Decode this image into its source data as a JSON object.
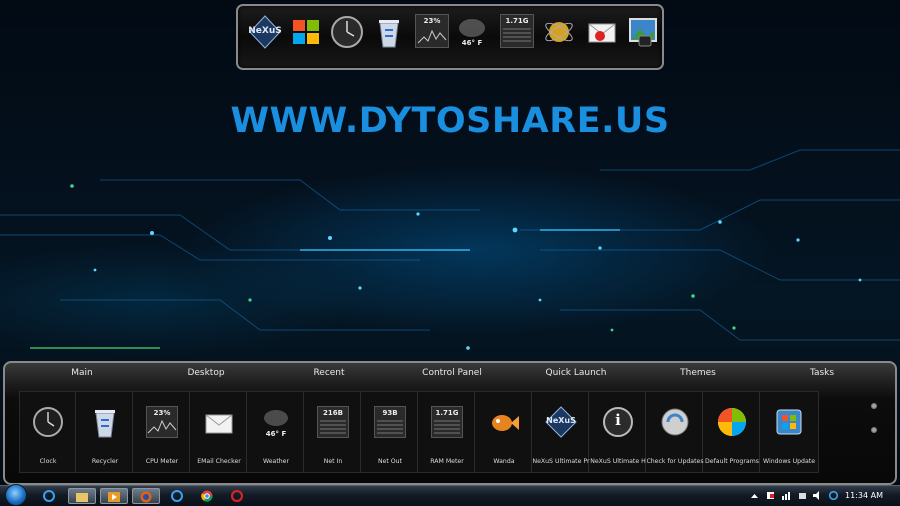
{
  "watermark": "WWW.DYTOSHARE.US",
  "top_dock": {
    "items": [
      {
        "name": "nexus-logo",
        "label": "NeXuS"
      },
      {
        "name": "windows-icon"
      },
      {
        "name": "clock-icon"
      },
      {
        "name": "recycle-bin-icon"
      },
      {
        "name": "cpu-meter",
        "value": "23%"
      },
      {
        "name": "weather-icon",
        "value": "46° F"
      },
      {
        "name": "ram-meter",
        "value": "1.71G"
      },
      {
        "name": "wanda-icon"
      },
      {
        "name": "email-icon"
      },
      {
        "name": "photo-icon"
      }
    ]
  },
  "bottom_dock": {
    "tabs": [
      "Main",
      "Desktop",
      "Recent",
      "Control Panel",
      "Quick Launch",
      "Themes",
      "Tasks"
    ],
    "items": [
      {
        "label": "Clock",
        "icon": "clock-icon"
      },
      {
        "label": "Recycler",
        "icon": "recycle-bin-icon"
      },
      {
        "label": "CPU Meter",
        "icon": "cpu-meter-icon",
        "value": "23%"
      },
      {
        "label": "EMail Checker",
        "icon": "email-icon"
      },
      {
        "label": "Weather",
        "icon": "weather-icon",
        "value": "46° F"
      },
      {
        "label": "Net In",
        "icon": "net-in-icon",
        "value": "216B"
      },
      {
        "label": "Net Out",
        "icon": "net-out-icon",
        "value": "93B"
      },
      {
        "label": "RAM Meter",
        "icon": "ram-meter-icon",
        "value": "1.71G"
      },
      {
        "label": "Wanda",
        "icon": "fish-icon"
      },
      {
        "label": "NeXuS Ultimate Pr",
        "icon": "nexus-icon",
        "value": "NeXuS"
      },
      {
        "label": "NeXuS Ultimate H",
        "icon": "info-icon",
        "value": "i"
      },
      {
        "label": "Check for Updates",
        "icon": "update-icon"
      },
      {
        "label": "Default Programs",
        "icon": "default-programs-icon"
      },
      {
        "label": "Windows Update",
        "icon": "windows-update-icon"
      }
    ]
  },
  "taskbar": {
    "clock": "11:34 AM",
    "buttons": [
      "ie-icon",
      "explorer-icon",
      "media-player-icon",
      "firefox-icon",
      "ie-icon",
      "chrome-icon",
      "opera-icon"
    ]
  },
  "colors": {
    "watermark": "#1a8fe0",
    "dock_border": "#8a8a8a",
    "tray_background": "#101010"
  }
}
